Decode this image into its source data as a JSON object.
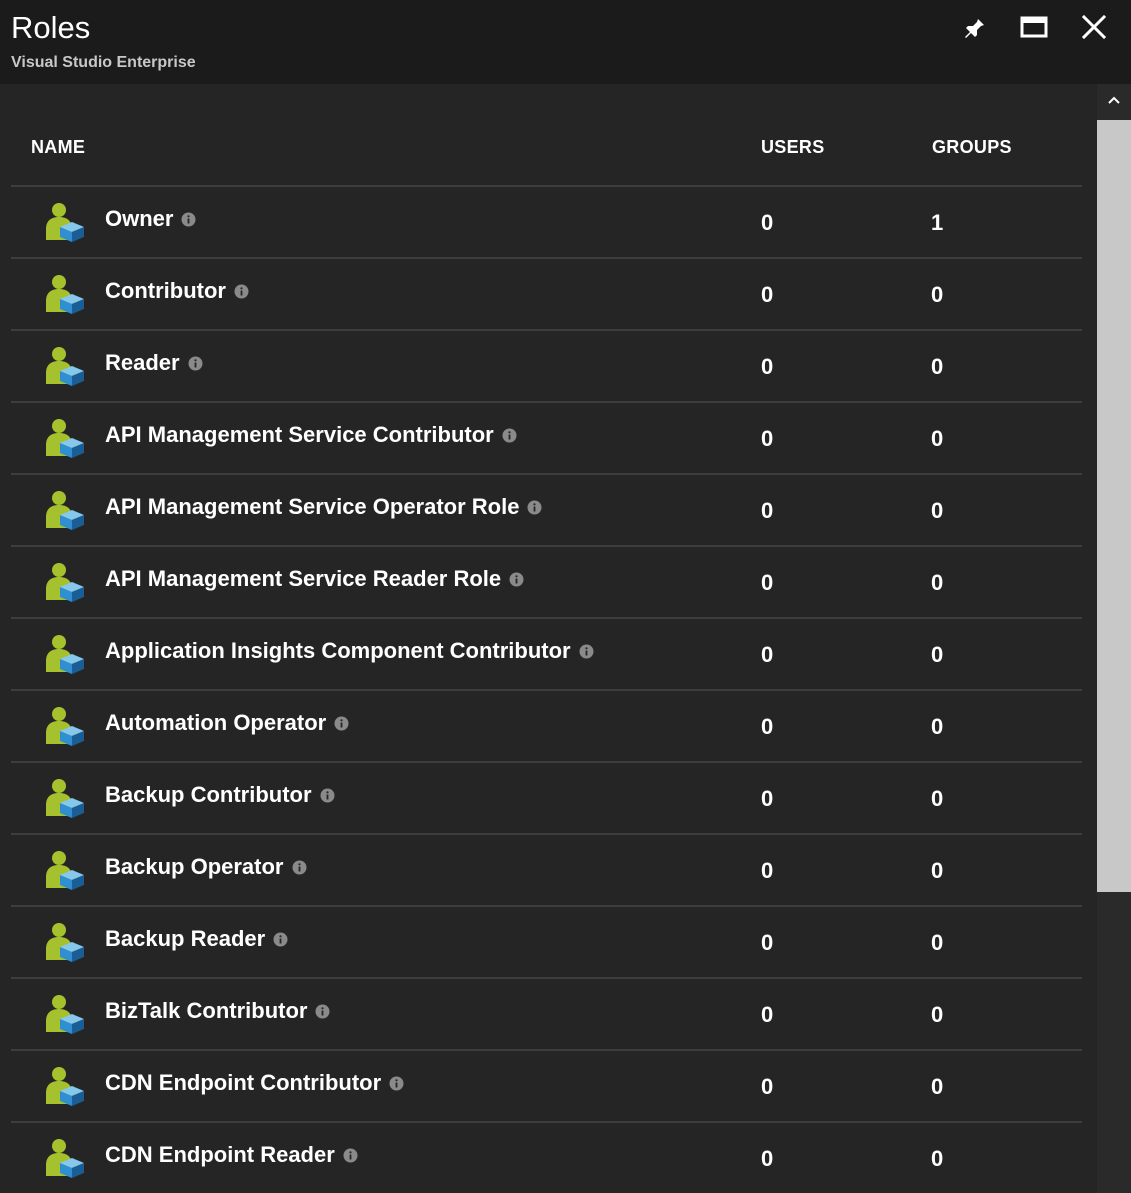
{
  "header": {
    "title": "Roles",
    "subtitle": "Visual Studio Enterprise",
    "pin_icon": "pin-icon",
    "maximize_icon": "maximize-icon",
    "close_icon": "close-icon"
  },
  "table": {
    "columns": {
      "name": "NAME",
      "users": "USERS",
      "groups": "GROUPS"
    },
    "rows": [
      {
        "name": "Owner",
        "users": "0",
        "groups": "1"
      },
      {
        "name": "Contributor",
        "users": "0",
        "groups": "0"
      },
      {
        "name": "Reader",
        "users": "0",
        "groups": "0"
      },
      {
        "name": "API Management Service Contributor",
        "users": "0",
        "groups": "0"
      },
      {
        "name": "API Management Service Operator Role",
        "users": "0",
        "groups": "0"
      },
      {
        "name": "API Management Service Reader Role",
        "users": "0",
        "groups": "0"
      },
      {
        "name": "Application Insights Component Contributor",
        "users": "0",
        "groups": "0"
      },
      {
        "name": "Automation Operator",
        "users": "0",
        "groups": "0"
      },
      {
        "name": "Backup Contributor",
        "users": "0",
        "groups": "0"
      },
      {
        "name": "Backup Operator",
        "users": "0",
        "groups": "0"
      },
      {
        "name": "Backup Reader",
        "users": "0",
        "groups": "0"
      },
      {
        "name": "BizTalk Contributor",
        "users": "0",
        "groups": "0"
      },
      {
        "name": "CDN Endpoint Contributor",
        "users": "0",
        "groups": "0"
      },
      {
        "name": "CDN Endpoint Reader",
        "users": "0",
        "groups": "0"
      }
    ]
  },
  "colors": {
    "background": "#252526",
    "header_background": "#1b1b1b",
    "divider": "#3d3d3d",
    "icon_green": "#a6c12e",
    "icon_blue": "#3fa7dd"
  },
  "icons": {
    "role_icon": "user-role-icon",
    "info_icon": "info-icon",
    "scroll_up_icon": "chevron-up-icon"
  }
}
